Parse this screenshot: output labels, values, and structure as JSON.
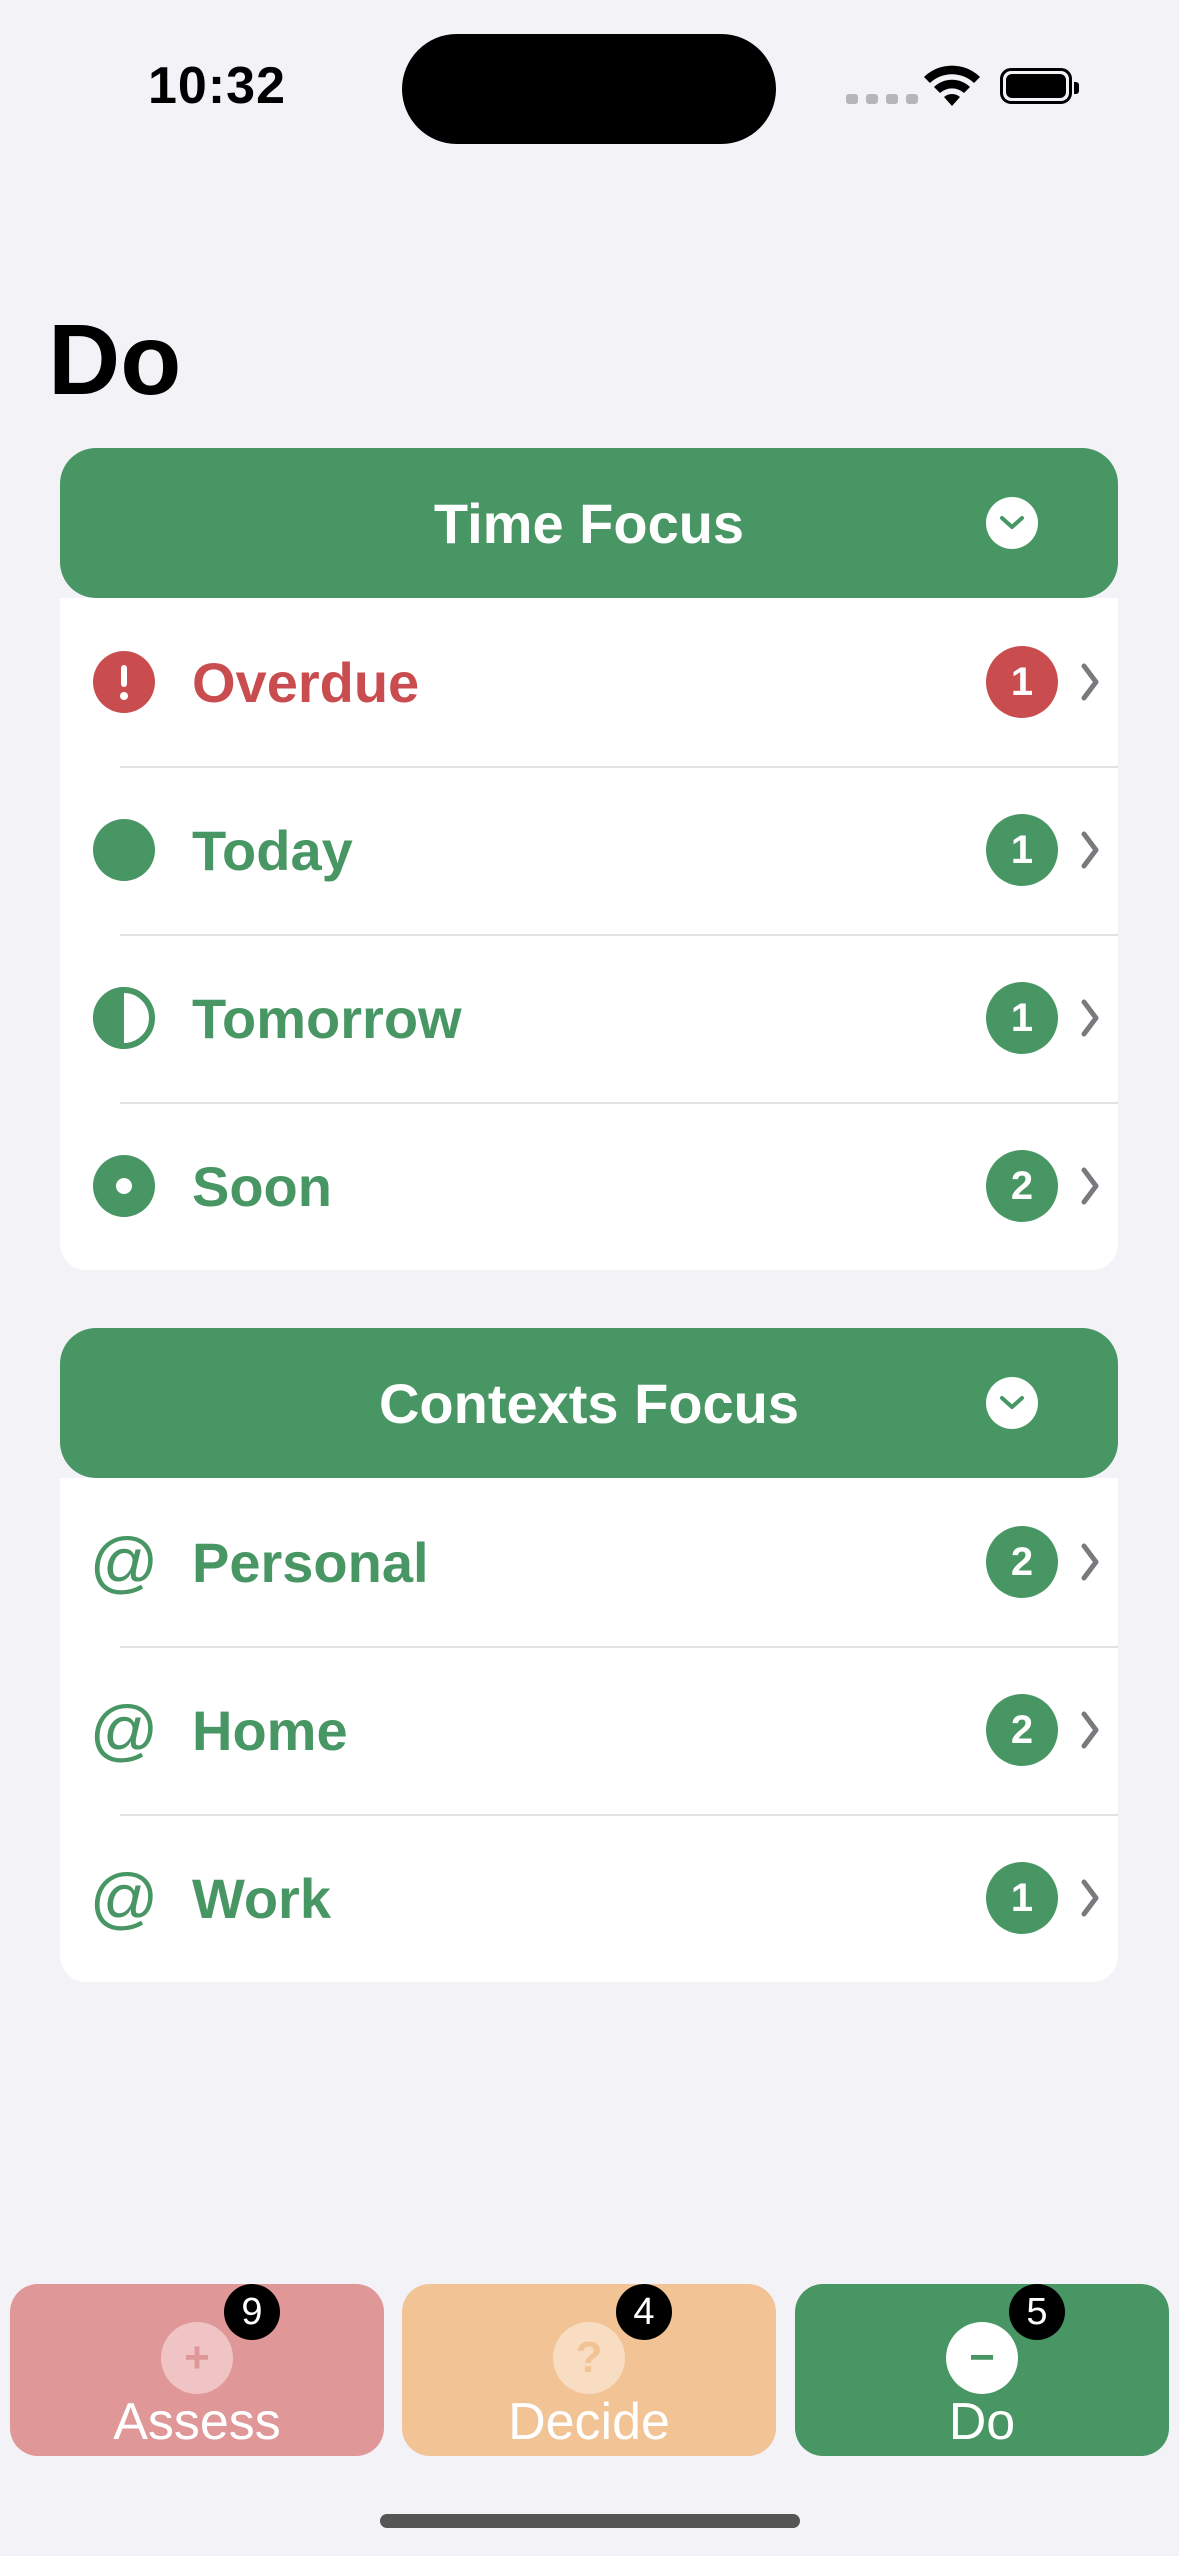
{
  "status": {
    "time": "10:32"
  },
  "page": {
    "title": "Do"
  },
  "colors": {
    "green": "#479663",
    "red": "#c94d4e",
    "assess": "#e09797",
    "decide": "#f2c394"
  },
  "time_focus": {
    "title": "Time Focus",
    "items": [
      {
        "label": "Overdue",
        "count": "1",
        "icon": "exclamation-circle-icon"
      },
      {
        "label": "Today",
        "count": "1",
        "icon": "full-circle-icon"
      },
      {
        "label": "Tomorrow",
        "count": "1",
        "icon": "half-circle-icon"
      },
      {
        "label": "Soon",
        "count": "2",
        "icon": "dot-circle-icon"
      }
    ]
  },
  "contexts_focus": {
    "title": "Contexts Focus",
    "items": [
      {
        "label": "Personal",
        "count": "2",
        "icon": "at-icon",
        "glyph": "@"
      },
      {
        "label": "Home",
        "count": "2",
        "icon": "at-icon",
        "glyph": "@"
      },
      {
        "label": "Work",
        "count": "1",
        "icon": "at-icon",
        "glyph": "@"
      }
    ]
  },
  "tabs": [
    {
      "label": "Assess",
      "badge": "9",
      "glyph": "+",
      "icon": "plus-circle-icon"
    },
    {
      "label": "Decide",
      "badge": "4",
      "glyph": "?",
      "icon": "question-circle-icon"
    },
    {
      "label": "Do",
      "badge": "5",
      "glyph": "−",
      "icon": "minus-circle-icon"
    }
  ]
}
